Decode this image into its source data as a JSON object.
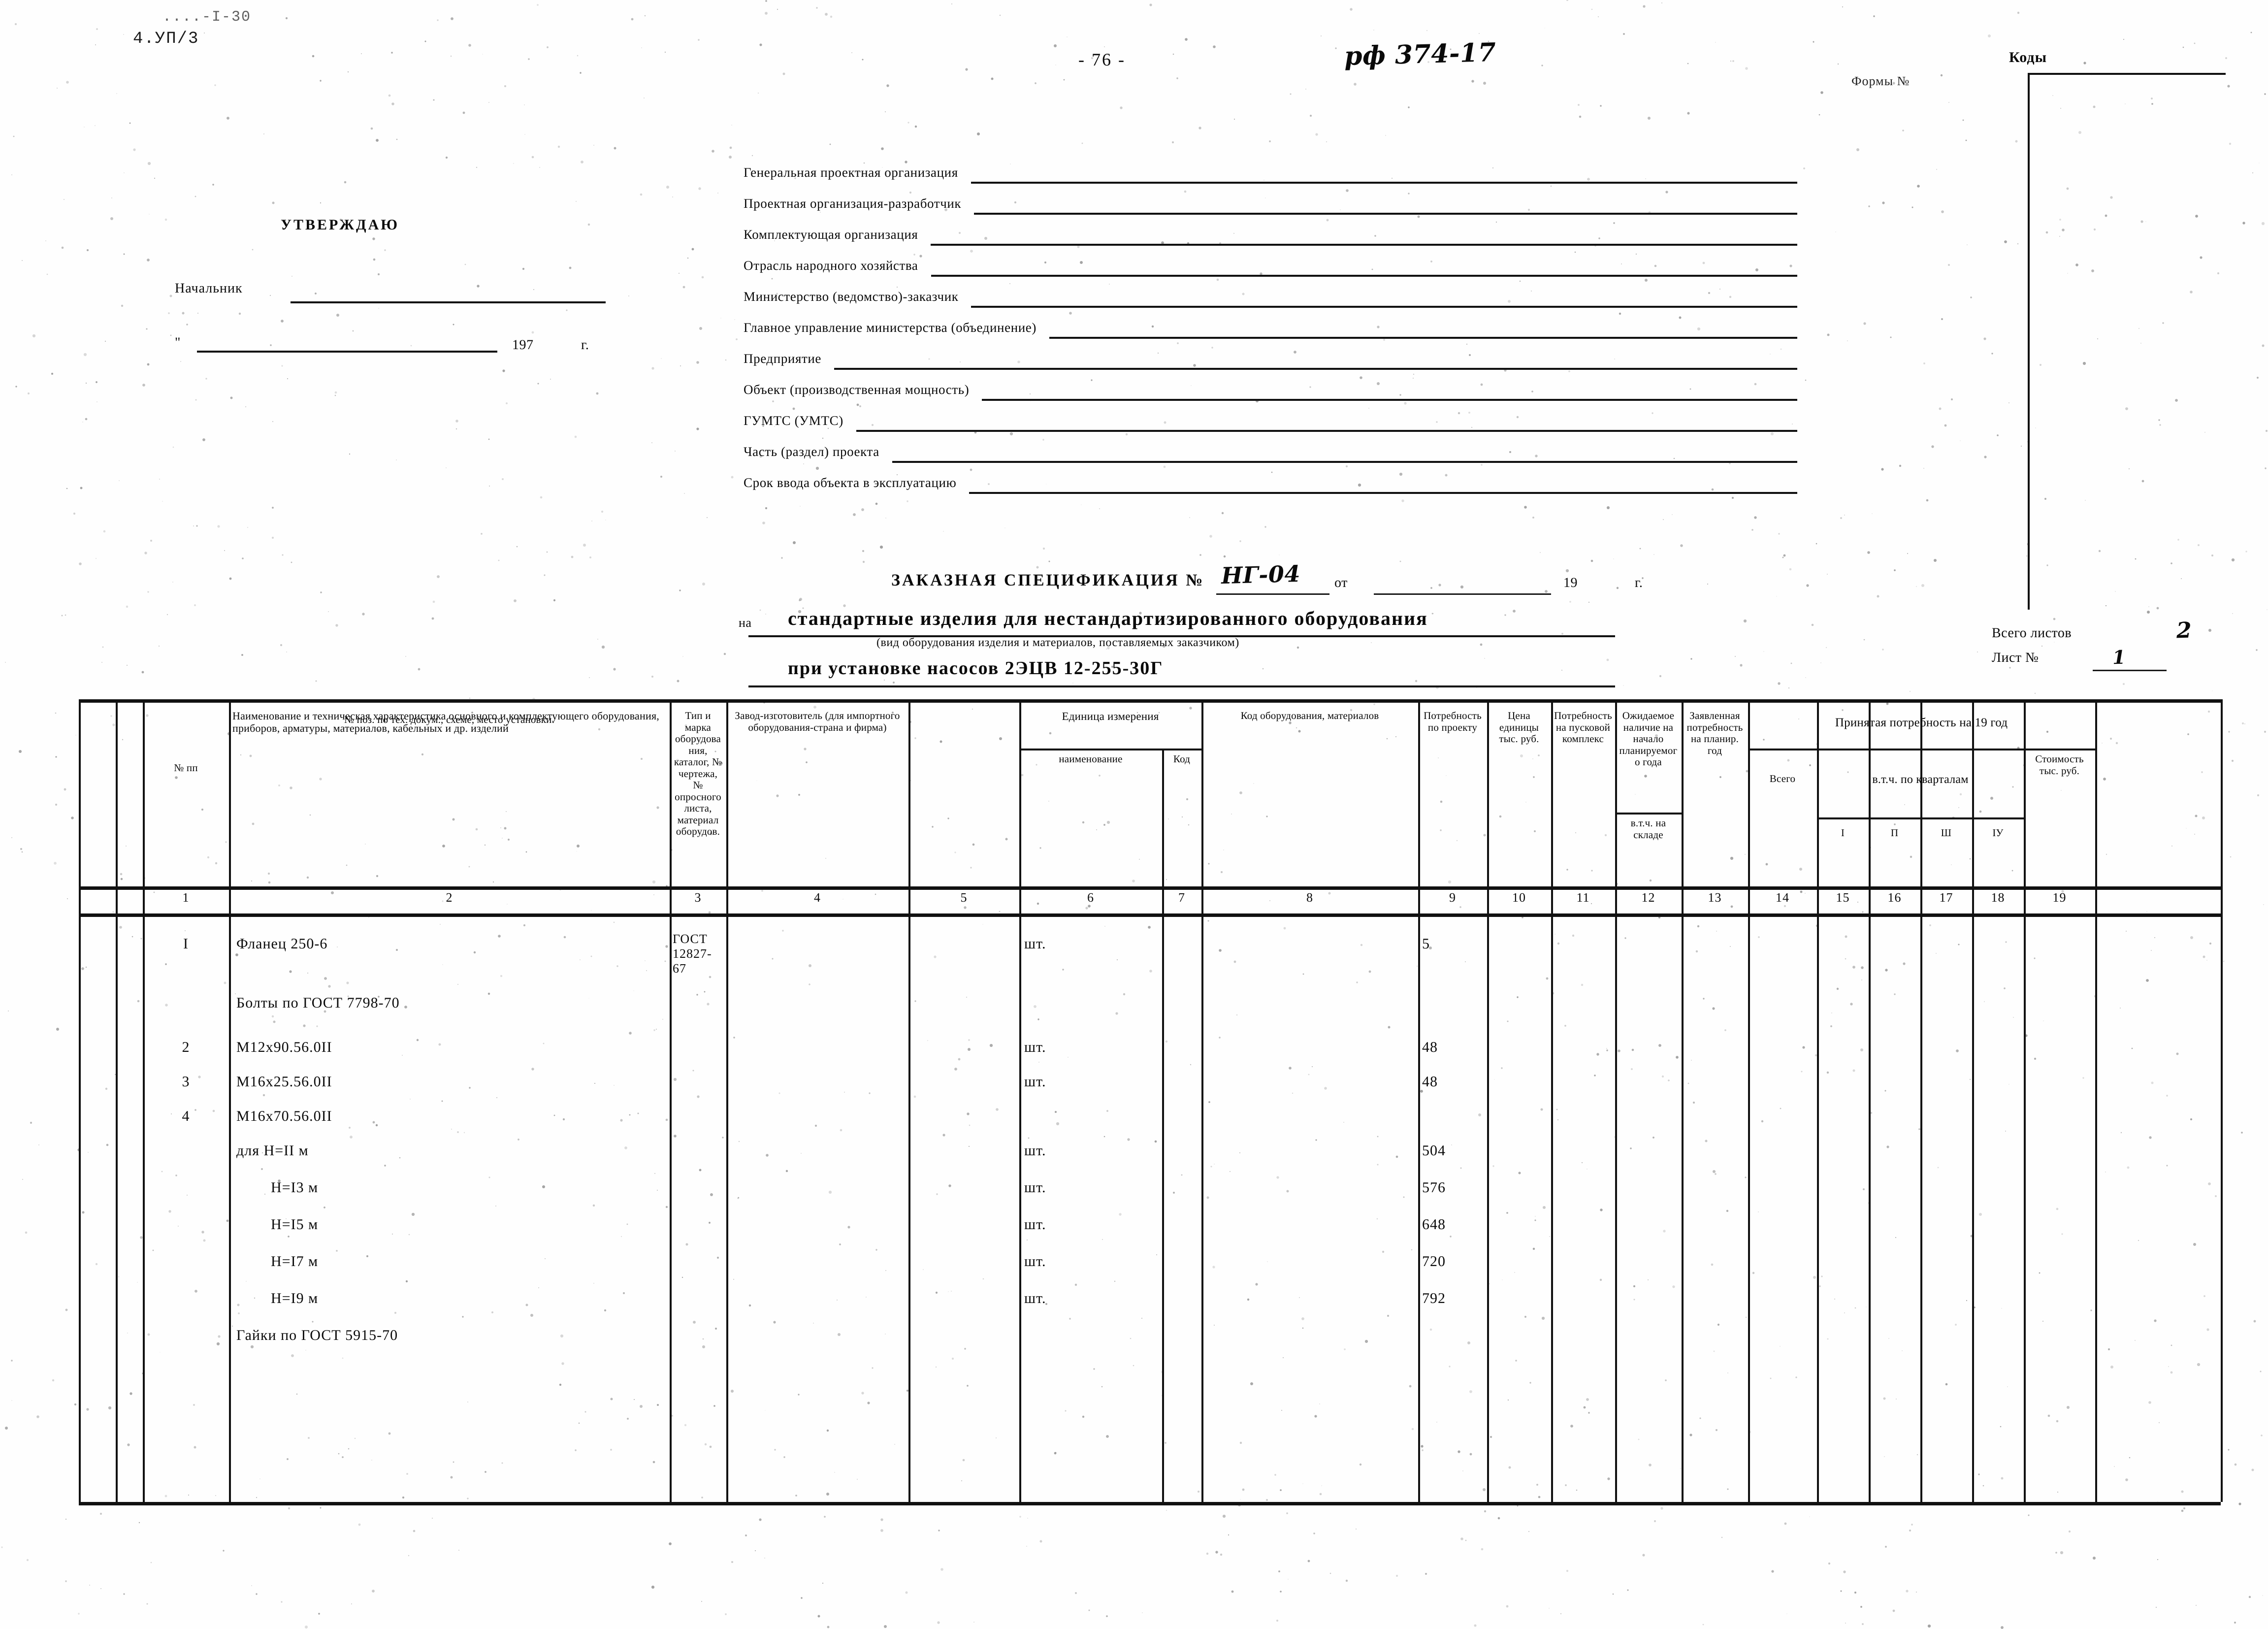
{
  "header": {
    "archive_code_faint": "....-I-30",
    "archive_code": "4.УП/3",
    "page_number": "- 76 -",
    "doc_reference_handwritten": "рф 374-17",
    "form_number_label": "Формы №",
    "codes_label": "Коды"
  },
  "approval": {
    "title": "УТВЕРЖДАЮ",
    "chief_label": "Начальник",
    "date_prefix": "\"",
    "date_year": "197",
    "date_suffix": "г."
  },
  "form_fields": [
    {
      "label": "Генеральная проектная организация"
    },
    {
      "label": "Проектная организация-разработчик"
    },
    {
      "label": "Комплектующая организация"
    },
    {
      "label": "Отрасль народного хозяйства"
    },
    {
      "label": "Министерство (ведомство)-заказчик"
    },
    {
      "label": "Главное управление министерства (объединение)"
    },
    {
      "label": "Предприятие"
    },
    {
      "label": "Объект (производственная мощность)"
    },
    {
      "label": "ГУМТС (УМТС)"
    },
    {
      "label": "Часть (раздел) проекта"
    },
    {
      "label": "Срок ввода объекта в эксплуатацию"
    }
  ],
  "specification": {
    "title_line1": "ЗАКАЗНАЯ СПЕЦИФИКАЦИЯ №",
    "number_handwritten": "НГ-04",
    "ot_label": "от",
    "year_prefix": "19",
    "year_suffix": "г.",
    "na_label": "на",
    "title_line2": "стандартные изделия для нестандартизированного оборудования",
    "subtitle": "(вид оборудования изделия и материалов, поставляемых заказчиком)",
    "title_line3": "при установке насосов 2ЭЦВ 12-255-30Г",
    "sheets_total_label": "Всего листов",
    "sheets_total_value": "2",
    "sheet_no_label": "Лист №",
    "sheet_no_value": "1"
  },
  "table": {
    "headers": [
      {
        "num": "1",
        "text": "№ пп"
      },
      {
        "num": "2",
        "text": "№ поз. по тех. докум., схеме, место установки."
      },
      {
        "num": "3",
        "text": "Наименование и техническая характеристика основного и комплектующего оборудования, приборов, арматуры, материалов, кабельных и др. изделий"
      },
      {
        "num": "4",
        "text": "Тип и марка оборудования, каталог, № чертежа, № опросного листа, материал оборудов."
      },
      {
        "num": "5",
        "text": "Завод-изготовитель (для импортного оборудования-страна и фирма)"
      },
      {
        "num": "6",
        "text": "наименование"
      },
      {
        "num": "7",
        "text": "Код"
      },
      {
        "num": "8",
        "text": "Код оборудования, материалов"
      },
      {
        "num": "9",
        "text": "Потребность по проекту"
      },
      {
        "num": "10",
        "text": "Цена единицы тыс. руб."
      },
      {
        "num": "11",
        "text": "Потребность на пусковой комплекс"
      },
      {
        "num": "12",
        "text": "Ожидаемое наличие на начало планируемого года"
      },
      {
        "num": "12b",
        "text": "в.т.ч. на складе"
      },
      {
        "num": "13",
        "text": "Заявленная потребность на планир. год"
      },
      {
        "num": "14",
        "text": "Всего"
      },
      {
        "num": "15",
        "text": "I"
      },
      {
        "num": "16",
        "text": "П"
      },
      {
        "num": "17",
        "text": "Ш"
      },
      {
        "num": "18",
        "text": "IУ"
      },
      {
        "num": "19",
        "text": "Стоимость тыс. руб."
      }
    ],
    "group_headers": {
      "unit": "Единица измерения",
      "accepted": "Принятая потребность на 19",
      "accepted_suffix": "год",
      "quarters": "в.т.ч. по кварталам"
    },
    "rows": [
      {
        "no": "I",
        "name": "Фланец 250-6",
        "type": "ГОСТ 12827-67",
        "unit": "шт.",
        "qty": "5"
      },
      {
        "no": "",
        "name": "Болты по ГОСТ 7798-70",
        "type": "",
        "unit": "",
        "qty": ""
      },
      {
        "no": "2",
        "name": "М12x90.56.0II",
        "type": "",
        "unit": "шт.",
        "qty": "48"
      },
      {
        "no": "3",
        "name": "М16x25.56.0II",
        "type": "",
        "unit": "шт.",
        "qty": "48"
      },
      {
        "no": "4",
        "name": "М16x70.56.0II",
        "type": "",
        "unit": "",
        "qty": ""
      },
      {
        "no": "",
        "name": "для H=II м",
        "type": "",
        "unit": "шт.",
        "qty": "504"
      },
      {
        "no": "",
        "name": "H=I3 м",
        "type": "",
        "unit": "шт.",
        "qty": "576"
      },
      {
        "no": "",
        "name": "H=I5 м",
        "type": "",
        "unit": "шт.",
        "qty": "648"
      },
      {
        "no": "",
        "name": "H=I7 м",
        "type": "",
        "unit": "шт.",
        "qty": "720"
      },
      {
        "no": "",
        "name": "H=I9 м",
        "type": "",
        "unit": "шт.",
        "qty": "792"
      },
      {
        "no": "",
        "name": "Гайки по ГОСТ 5915-70",
        "type": "",
        "unit": "",
        "qty": ""
      }
    ]
  }
}
